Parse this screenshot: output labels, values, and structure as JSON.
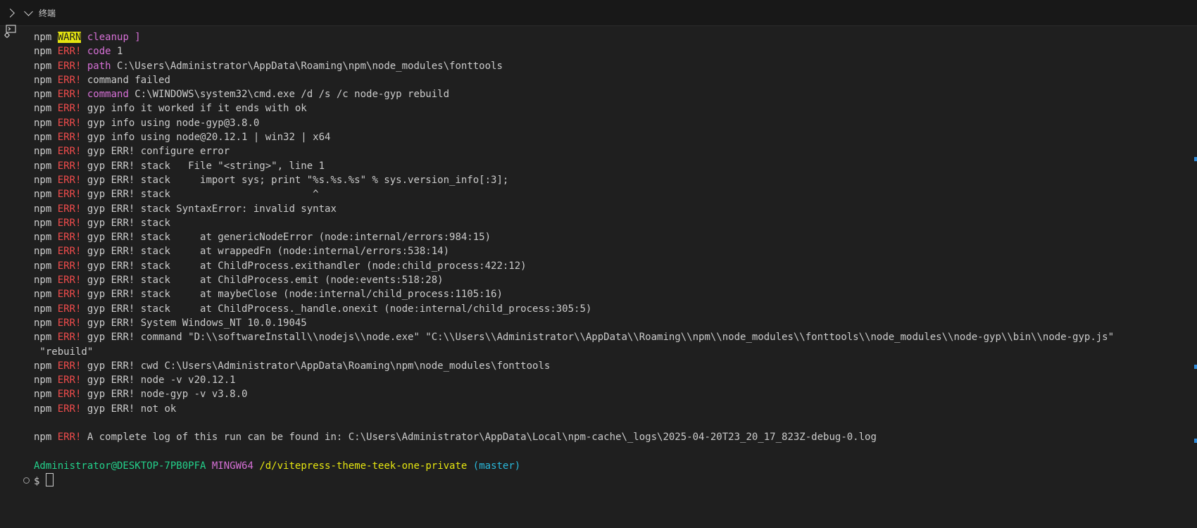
{
  "panel": {
    "section_title": "终端"
  },
  "icons": {
    "toggle": "chevron-right-icon",
    "section": "chevron-down-icon",
    "terminal": "terminal-icon",
    "command_marker": "command-marker-icon"
  },
  "colors": {
    "background": "#1f1f1f",
    "text": "#cccccc",
    "error_red": "#f14c4c",
    "warn_bg": "#e5e510",
    "magenta": "#d670d6",
    "green": "#23d18b",
    "cyan": "#29b8db",
    "scroll_marker": "#2f8ad8"
  },
  "terminal": {
    "lines": [
      [
        [
          "npm ",
          "npm"
        ],
        [
          "WARN",
          "warn"
        ],
        [
          " cleanup ]",
          "cmd_cleanup"
        ]
      ],
      [
        [
          "npm ",
          "npm"
        ],
        [
          "ERR!",
          "err"
        ],
        [
          " code",
          "cmd"
        ],
        [
          " 1",
          "plain"
        ]
      ],
      [
        [
          "npm ",
          "npm"
        ],
        [
          "ERR!",
          "err"
        ],
        [
          " path",
          "cmd"
        ],
        [
          " C:\\Users\\Administrator\\AppData\\Roaming\\npm\\node_modules\\fonttools",
          "plain"
        ]
      ],
      [
        [
          "npm ",
          "npm"
        ],
        [
          "ERR!",
          "err"
        ],
        [
          " command failed",
          "plain"
        ]
      ],
      [
        [
          "npm ",
          "npm"
        ],
        [
          "ERR!",
          "err"
        ],
        [
          " command",
          "cmd"
        ],
        [
          " C:\\WINDOWS\\system32\\cmd.exe /d /s /c node-gyp rebuild",
          "plain"
        ]
      ],
      [
        [
          "npm ",
          "npm"
        ],
        [
          "ERR!",
          "err"
        ],
        [
          " gyp info it worked if it ends with ok",
          "plain"
        ]
      ],
      [
        [
          "npm ",
          "npm"
        ],
        [
          "ERR!",
          "err"
        ],
        [
          " gyp info using node-gyp@3.8.0",
          "plain"
        ]
      ],
      [
        [
          "npm ",
          "npm"
        ],
        [
          "ERR!",
          "err"
        ],
        [
          " gyp info using node@20.12.1 | win32 | x64",
          "plain"
        ]
      ],
      [
        [
          "npm ",
          "npm"
        ],
        [
          "ERR!",
          "err"
        ],
        [
          " gyp ERR! configure error",
          "plain"
        ]
      ],
      [
        [
          "npm ",
          "npm"
        ],
        [
          "ERR!",
          "err"
        ],
        [
          " gyp ERR! stack   File \"<string>\", line 1",
          "plain"
        ]
      ],
      [
        [
          "npm ",
          "npm"
        ],
        [
          "ERR!",
          "err"
        ],
        [
          " gyp ERR! stack     import sys; print \"%s.%s.%s\" % sys.version_info[:3];",
          "plain"
        ]
      ],
      [
        [
          "npm ",
          "npm"
        ],
        [
          "ERR!",
          "err"
        ],
        [
          " gyp ERR! stack                        ^",
          "plain"
        ]
      ],
      [
        [
          "npm ",
          "npm"
        ],
        [
          "ERR!",
          "err"
        ],
        [
          " gyp ERR! stack SyntaxError: invalid syntax",
          "plain"
        ]
      ],
      [
        [
          "npm ",
          "npm"
        ],
        [
          "ERR!",
          "err"
        ],
        [
          " gyp ERR! stack",
          "plain"
        ]
      ],
      [
        [
          "npm ",
          "npm"
        ],
        [
          "ERR!",
          "err"
        ],
        [
          " gyp ERR! stack     at genericNodeError (node:internal/errors:984:15)",
          "plain"
        ]
      ],
      [
        [
          "npm ",
          "npm"
        ],
        [
          "ERR!",
          "err"
        ],
        [
          " gyp ERR! stack     at wrappedFn (node:internal/errors:538:14)",
          "plain"
        ]
      ],
      [
        [
          "npm ",
          "npm"
        ],
        [
          "ERR!",
          "err"
        ],
        [
          " gyp ERR! stack     at ChildProcess.exithandler (node:child_process:422:12)",
          "plain"
        ]
      ],
      [
        [
          "npm ",
          "npm"
        ],
        [
          "ERR!",
          "err"
        ],
        [
          " gyp ERR! stack     at ChildProcess.emit (node:events:518:28)",
          "plain"
        ]
      ],
      [
        [
          "npm ",
          "npm"
        ],
        [
          "ERR!",
          "err"
        ],
        [
          " gyp ERR! stack     at maybeClose (node:internal/child_process:1105:16)",
          "plain"
        ]
      ],
      [
        [
          "npm ",
          "npm"
        ],
        [
          "ERR!",
          "err"
        ],
        [
          " gyp ERR! stack     at ChildProcess._handle.onexit (node:internal/child_process:305:5)",
          "plain"
        ]
      ],
      [
        [
          "npm ",
          "npm"
        ],
        [
          "ERR!",
          "err"
        ],
        [
          " gyp ERR! System Windows_NT 10.0.19045",
          "plain"
        ]
      ],
      [
        [
          "npm ",
          "npm"
        ],
        [
          "ERR!",
          "err"
        ],
        [
          " gyp ERR! command \"D:\\\\softwareInstall\\\\nodejs\\\\node.exe\" \"C:\\\\Users\\\\Administrator\\\\AppData\\\\Roaming\\\\npm\\\\node_modules\\\\fonttools\\\\node_modules\\\\node-gyp\\\\bin\\\\node-gyp.js\"",
          "plain"
        ]
      ],
      [
        [
          " \"rebuild\"",
          "plain"
        ]
      ],
      [
        [
          "npm ",
          "npm"
        ],
        [
          "ERR!",
          "err"
        ],
        [
          " gyp ERR! cwd C:\\Users\\Administrator\\AppData\\Roaming\\npm\\node_modules\\fonttools",
          "plain"
        ]
      ],
      [
        [
          "npm ",
          "npm"
        ],
        [
          "ERR!",
          "err"
        ],
        [
          " gyp ERR! node -v v20.12.1",
          "plain"
        ]
      ],
      [
        [
          "npm ",
          "npm"
        ],
        [
          "ERR!",
          "err"
        ],
        [
          " gyp ERR! node-gyp -v v3.8.0",
          "plain"
        ]
      ],
      [
        [
          "npm ",
          "npm"
        ],
        [
          "ERR!",
          "err"
        ],
        [
          " gyp ERR! not ok",
          "plain"
        ]
      ],
      [
        [
          "",
          "plain"
        ]
      ],
      [
        [
          "npm ",
          "npm"
        ],
        [
          "ERR!",
          "err"
        ],
        [
          " A complete log of this run can be found in: C:\\Users\\Administrator\\AppData\\Local\\npm-cache\\_logs\\2025-04-20T23_20_17_823Z-debug-0.log",
          "plain"
        ]
      ],
      [
        [
          "",
          "plain"
        ]
      ]
    ],
    "prompt": {
      "user_host": "Administrator@DESKTOP-7PB0PFA",
      "shell": "MINGW64",
      "cwd": "/d/vitepress-theme-teek-one-private",
      "branch": "(master)",
      "symbol": "$"
    }
  }
}
